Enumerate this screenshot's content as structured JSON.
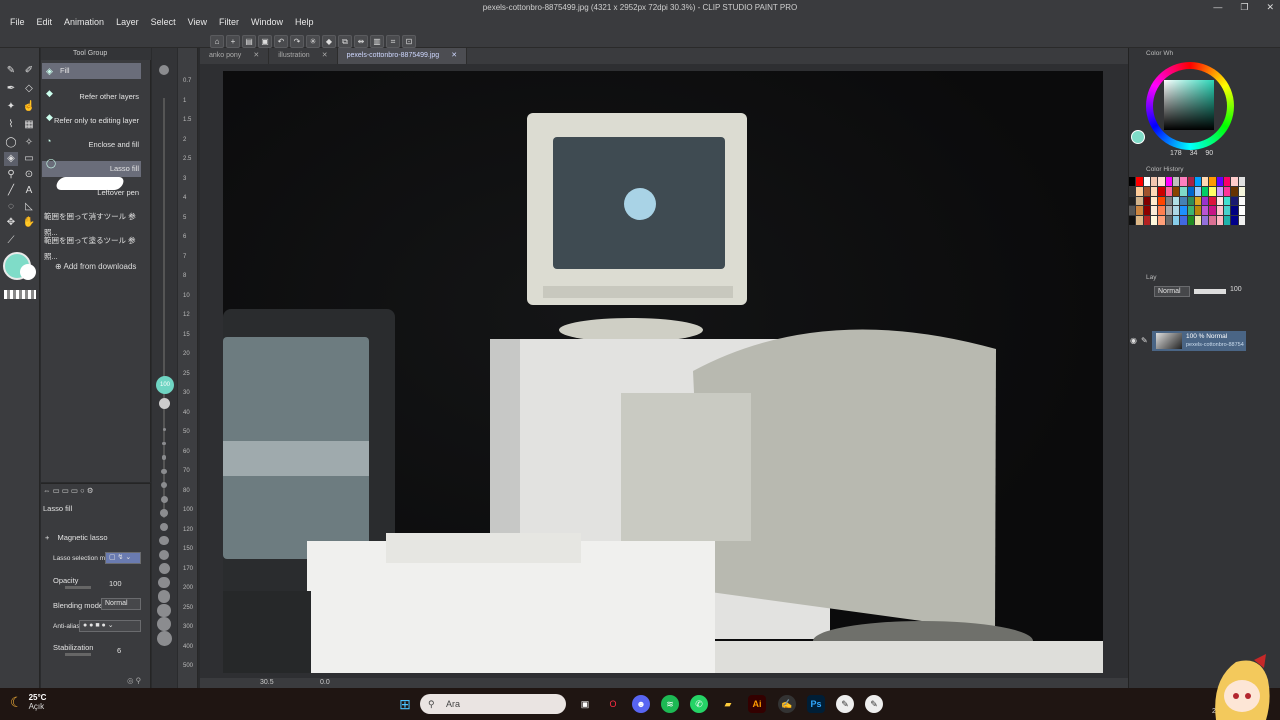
{
  "window": {
    "title": "pexels-cottonbro-8875499.jpg (4321 x 2952px 72dpi 30.3%) - CLIP STUDIO PAINT PRO",
    "controls": [
      "—",
      "❐",
      "✕"
    ]
  },
  "menu": [
    "File",
    "Edit",
    "Animation",
    "Layer",
    "Select",
    "View",
    "Filter",
    "Window",
    "Help"
  ],
  "subtool": {
    "group_label": "Tool Group",
    "items": [
      {
        "label": "Fill",
        "selected": true
      },
      {
        "label": "Refer other layers"
      },
      {
        "label": "Refer only to editing layer"
      },
      {
        "label": "Enclose and fill"
      },
      {
        "label": "Lasso fill",
        "selected": true
      },
      {
        "label": "Leftover pen"
      },
      {
        "label": "範囲を囲って消すツール 参照..."
      },
      {
        "label": "範囲を囲って塗るツール 参照..."
      }
    ],
    "add_from_downloads": "Add from downloads"
  },
  "brush_size_badge": "100",
  "ruler_marks": [
    "0.7",
    "1",
    "1.5",
    "2",
    "2.5",
    "3",
    "4",
    "5",
    "6",
    "7",
    "8",
    "10",
    "12",
    "15",
    "20",
    "25",
    "30",
    "40",
    "50",
    "60",
    "70",
    "80",
    "100",
    "120",
    "150",
    "170",
    "200",
    "250",
    "300",
    "400",
    "500"
  ],
  "tool_property": {
    "title": "Lasso fill",
    "magnetic_lasso": "Magnetic lasso",
    "lasso_selection_mode": "Lasso selection mod",
    "opacity_label": "Opacity",
    "opacity_value": "100",
    "blending_label": "Blending mode",
    "blending_value": "Normal",
    "antialias_label": "Anti-alias",
    "stabilization_label": "Stabilization",
    "stabilization_value": "6"
  },
  "tabs": [
    {
      "label": "anko pony",
      "active": false
    },
    {
      "label": "illustration",
      "active": false
    },
    {
      "label": "pexels-cottonbro-8875499.jpg",
      "active": true
    }
  ],
  "status": {
    "zoom": "30.5",
    "angle": "0.0"
  },
  "color_wheel": {
    "title": "Color Wh",
    "h": "178",
    "s": "34",
    "v": "90",
    "main_color": "#7fdcc8"
  },
  "color_history": {
    "title": "Color History",
    "colors": [
      "#000000",
      "#ff0000",
      "#ffffff",
      "#f2c6b0",
      "#ffe0d0",
      "#ff00ff",
      "#c0c0c0",
      "#ff80c0",
      "#aa2244",
      "#00a0ff",
      "#ffd9b3",
      "#ff9900",
      "#6600ff",
      "#ff0066",
      "#ffcccc",
      "#e0e0e0",
      "#333333",
      "#ffcc99",
      "#a0522d",
      "#ffdab9",
      "#cc0000",
      "#ff6699",
      "#884400",
      "#7fdcc8",
      "#0066cc",
      "#99ccff",
      "#00cc66",
      "#ffff66",
      "#cc99ff",
      "#ff3399",
      "#663300",
      "#f5f5dc",
      "#222222",
      "#d2b48c",
      "#800000",
      "#ffebcd",
      "#ff4500",
      "#808080",
      "#b0e0e6",
      "#4682b4",
      "#2e8b57",
      "#daa520",
      "#9932cc",
      "#dc143c",
      "#ffe4e1",
      "#40e0d0",
      "#191970",
      "#fafafa",
      "#555555",
      "#cd853f",
      "#8b0000",
      "#faebd7",
      "#ff7f50",
      "#a9a9a9",
      "#add8e6",
      "#1e90ff",
      "#3cb371",
      "#b8860b",
      "#ba55d3",
      "#c71585",
      "#ffc0cb",
      "#48d1cc",
      "#000080",
      "#ffffff",
      "#111111",
      "#deb887",
      "#b22222",
      "#fff8dc",
      "#ffa07a",
      "#696969",
      "#87ceeb",
      "#4169e1",
      "#228b22",
      "#eee8aa",
      "#9370db",
      "#db7093",
      "#ffb6c1",
      "#20b2aa",
      "#00008b",
      "#f0f0f0"
    ]
  },
  "layer_panel": {
    "title": "Lay",
    "blend_mode": "Normal",
    "opacity": "100",
    "layer_line1": "100 % Normal",
    "layer_line2": "pexels-cottonbro-88754"
  },
  "taskbar": {
    "temperature": "25°C",
    "condition": "Açık",
    "search_placeholder": "Ara",
    "time": "20"
  }
}
